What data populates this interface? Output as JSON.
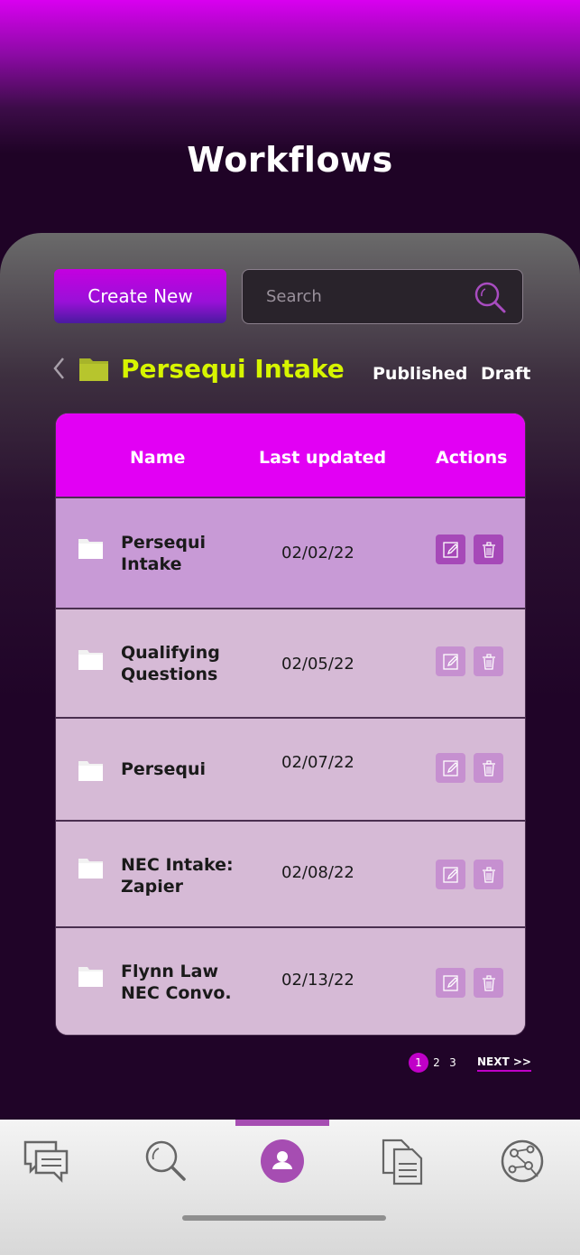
{
  "page": {
    "title": "Workflows"
  },
  "toolbar": {
    "create_label": "Create New",
    "search_placeholder": "Search"
  },
  "folder": {
    "title": "Persequi Intake",
    "tabs": [
      "Published",
      "Draft"
    ]
  },
  "table": {
    "columns": [
      "Name",
      "Last updated",
      "Actions"
    ],
    "rows": [
      {
        "name": "Persequi\nIntake",
        "date": "02/02/22"
      },
      {
        "name": "Qualifying\nQuestions",
        "date": "02/05/22"
      },
      {
        "name": "Persequi",
        "date": "02/07/22"
      },
      {
        "name": "NEC Intake:\nZapier",
        "date": "02/08/22"
      },
      {
        "name": "Flynn Law\nNEC Convo.",
        "date": "02/13/22"
      }
    ]
  },
  "pagination": {
    "pages": [
      "1",
      "2",
      "3"
    ],
    "current": "1",
    "next_label": "NEXT >>"
  },
  "bottom_nav": {
    "items": [
      "chat-icon",
      "search-icon",
      "profile-icon",
      "documents-icon",
      "network-icon"
    ],
    "active": "profile-icon"
  },
  "colors": {
    "accent": "#e200f4",
    "folder_title": "#d7f500",
    "active_nav": "#a64db2"
  }
}
